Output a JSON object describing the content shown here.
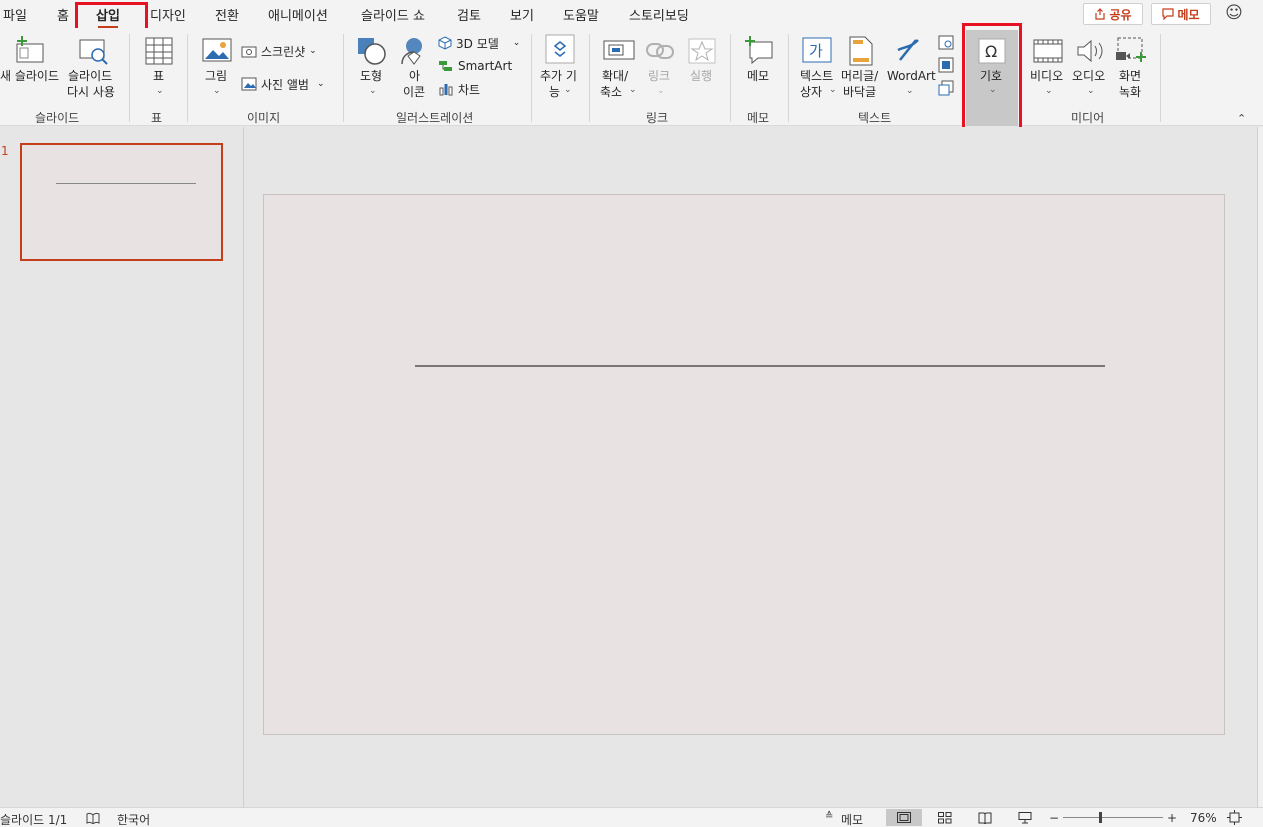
{
  "menu": {
    "tabs": [
      "파일",
      "홈",
      "삽입",
      "디자인",
      "전환",
      "애니메이션",
      "슬라이드 쇼",
      "검토",
      "보기",
      "도움말",
      "스토리보딩"
    ],
    "active_tab": "삽입",
    "share_label": "공유",
    "comment_label": "메모"
  },
  "ribbon": {
    "slides": {
      "new_slide": "새 슬라이드",
      "reuse_line1": "슬라이드",
      "reuse_line2": "다시 사용",
      "group": "슬라이드"
    },
    "tables": {
      "table": "표",
      "group": "표"
    },
    "images": {
      "pictures": "그림",
      "screenshot": "스크린샷",
      "photo_album": "사진 앨범",
      "group": "이미지"
    },
    "illustrations": {
      "shapes": "도형",
      "icons_line1": "아",
      "icons_line2": "이콘",
      "models3d": "3D 모델",
      "smartart": "SmartArt",
      "chart": "차트",
      "group": "일러스트레이션"
    },
    "addins": {
      "line1": "추가 기",
      "line2": "능"
    },
    "links": {
      "zoom_line1": "확대/",
      "zoom_line2": "축소",
      "link": "링크",
      "action": "실행",
      "group": "링크"
    },
    "comments": {
      "comment": "메모",
      "group": "메모"
    },
    "text": {
      "textbox_line1": "텍스트",
      "textbox_line2": "상자",
      "header_line1": "머리글/",
      "header_line2": "바닥글",
      "wordart": "WordArt",
      "group": "텍스트"
    },
    "symbols": {
      "symbol": "기호",
      "tooltip": "기호"
    },
    "media": {
      "video": "비디오",
      "audio": "오디오",
      "record_line1": "화면",
      "record_line2": "녹화",
      "group": "미디어"
    }
  },
  "thumbnails": {
    "slide_number": "1"
  },
  "status": {
    "slide_info": "슬라이드 1/1",
    "language": "한국어",
    "notes": "메모",
    "zoom_minus": "−",
    "zoom_plus": "+",
    "zoom": "76%"
  },
  "colors": {
    "accent": "#c43e1c",
    "highlight": "#e81123"
  }
}
